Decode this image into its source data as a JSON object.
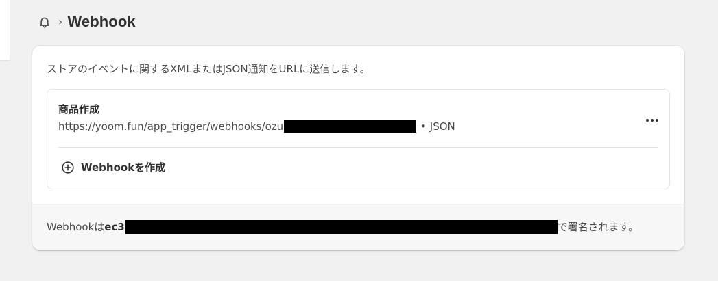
{
  "breadcrumb": {
    "icon": "bell-icon",
    "separator": "›",
    "title": "Webhook"
  },
  "card": {
    "description": "ストアのイベントに関するXMLまたはJSON通知をURLに送信します。",
    "webhooks": [
      {
        "event": "商品作成",
        "url_visible": "https://yoom.fun/app_trigger/webhooks/ozu",
        "url_redacted": true,
        "format": "• JSON",
        "more_icon": "more-horizontal-icon"
      }
    ],
    "create_button": {
      "icon": "plus-circle-icon",
      "label": "Webhookを作成"
    }
  },
  "footer": {
    "prefix": "Webhookは",
    "key_visible": "ec3",
    "key_redacted": true,
    "suffix": "で署名されます。"
  },
  "colors": {
    "background": "#f1f1f1",
    "card": "#ffffff",
    "footer": "#f7f7f7",
    "text": "#303030",
    "muted_text": "#4a4a4a",
    "border": "#e3e3e3",
    "redaction": "#000000"
  }
}
